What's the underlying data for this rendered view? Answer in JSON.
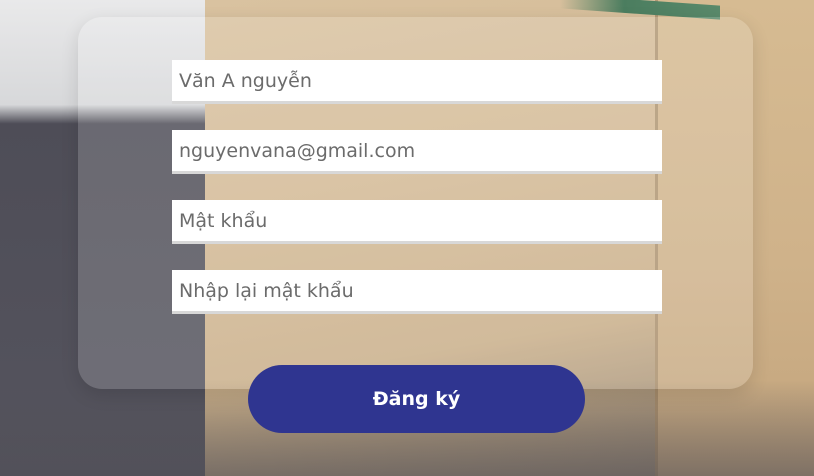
{
  "form": {
    "fields": [
      {
        "name": "full-name",
        "value": "Văn A nguyễn",
        "placeholder": ""
      },
      {
        "name": "email",
        "value": "nguyenvana@gmail.com",
        "placeholder": ""
      },
      {
        "name": "password",
        "value": "",
        "placeholder": "Mật khẩu"
      },
      {
        "name": "confirm-password",
        "value": "",
        "placeholder": "Nhập lại mật khẩu"
      }
    ],
    "submit_label": "Đăng ký"
  },
  "colors": {
    "button": "#2f3590",
    "field_text": "#6b6b6b",
    "field_border": "#d8d8d8"
  }
}
